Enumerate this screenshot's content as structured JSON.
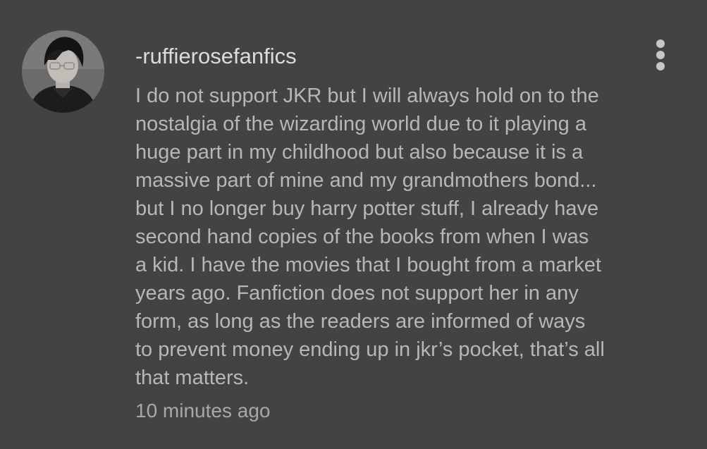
{
  "comment": {
    "username": "-ruffierosefanfics",
    "menu_icon": "more-vertical-icon",
    "avatar_icon": "user-avatar-photo",
    "body_lines": [
      "I do not support JKR but I will always hold on to the",
      "nostalgia of the wizarding world due to it playing a",
      "huge part in my childhood but also because it is a",
      "massive part of mine and my grandmothers bond...",
      "but I no longer buy harry potter stuff, I already have",
      "second hand copies of the books from when I was",
      "a kid. I have the movies that I bought from a market",
      "years ago. Fanfiction does not support her in any",
      "form, as long as the readers are informed of ways",
      "to prevent money ending up in jkr’s pocket, that’s all",
      "that matters."
    ],
    "timestamp": "10 minutes ago"
  },
  "colors": {
    "background": "#434343",
    "username": "#dcdcdc",
    "body_text": "#b7b7b7",
    "timestamp": "#a8a8a8",
    "menu_dots": "#c7c7c7"
  }
}
